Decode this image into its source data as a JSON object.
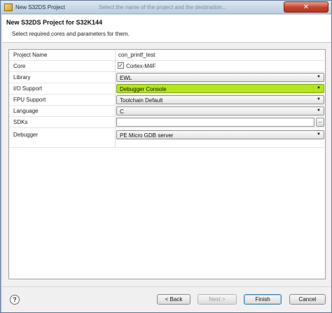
{
  "window": {
    "title": "New S32DS Project",
    "background_text": "Select the name of the project and the destination...",
    "close_glyph": "✕"
  },
  "header": {
    "title": "New S32DS Project for S32K144",
    "description": "Select required cores and parameters for them."
  },
  "params": {
    "project_name": {
      "label": "Project Name",
      "value": "con_printf_test"
    },
    "core": {
      "label": "Core",
      "option": "Cortex-M4F",
      "checked": true,
      "check_glyph": "✓"
    },
    "library": {
      "label": "Library",
      "value": "EWL"
    },
    "io_support": {
      "label": "I/O Support",
      "value": "Debugger Console"
    },
    "fpu_support": {
      "label": "FPU Support",
      "value": "Toolchain Default"
    },
    "language": {
      "label": "Language",
      "value": "C"
    },
    "sdks": {
      "label": "SDKs",
      "value": "",
      "browse_label": "..."
    },
    "debugger": {
      "label": "Debugger",
      "value": "PE Micro GDB server"
    }
  },
  "dropdown_arrow": "▼",
  "footer": {
    "help_label": "?",
    "back_label": "< Back",
    "next_label": "Next >",
    "finish_label": "Finish",
    "cancel_label": "Cancel"
  },
  "colors": {
    "highlight": "#b5e61d",
    "close_button": "#c2432c"
  }
}
